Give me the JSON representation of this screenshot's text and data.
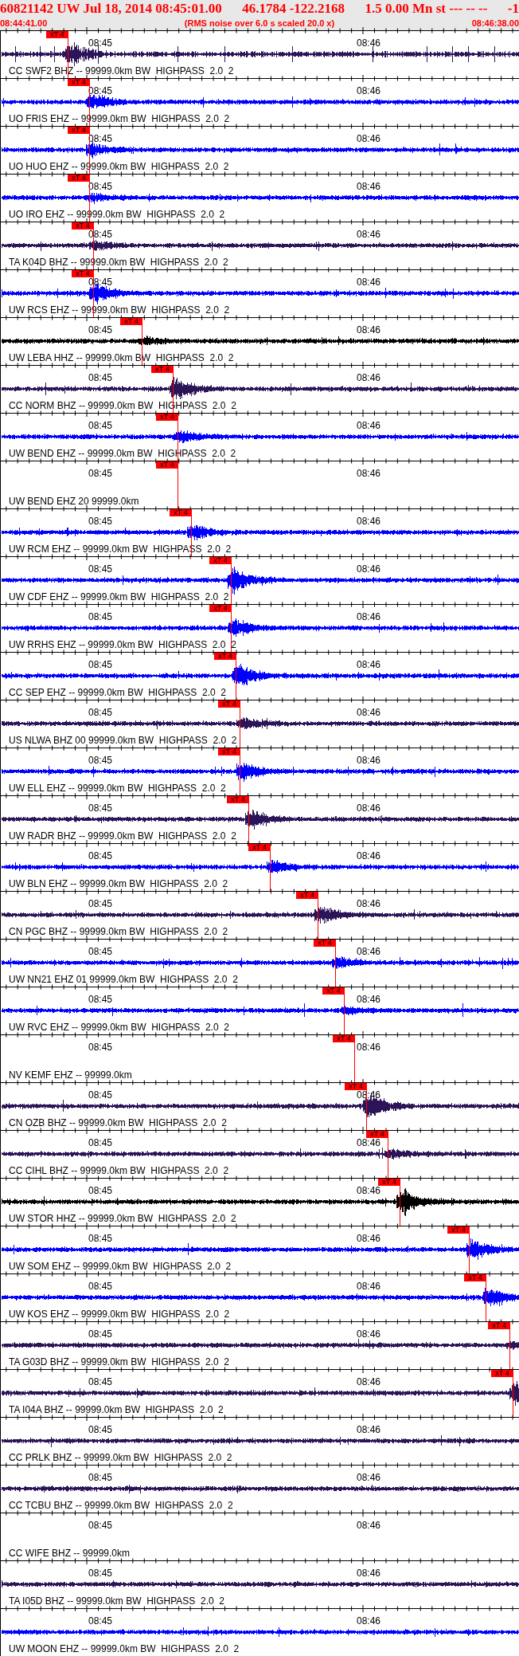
{
  "header": {
    "title_parts": [
      "60821142 UW Jul 18, 2014 08:45:01.00",
      "46.1784 -122.2168",
      "1.5 0.00 Mn st --- -- --",
      "-1"
    ],
    "start_time": "08:44:41.00",
    "note": "(RMS noise over 6.0 s scaled 20.0 x)",
    "end_time": "08:46:38.00"
  },
  "traces": [
    {
      "label": "CC SWF2 BHZ -- 99999.0km BW  HIGHPASS  2.0  2",
      "color": "#2b1457",
      "time_labels": [
        "08:45",
        "08:46"
      ],
      "pick": {
        "label": "xT 4",
        "level": 0.13
      }
    },
    {
      "label": "UO FRIS EHZ -- 99999.0km BW  HIGHPASS  2.0  2",
      "color": "#0000ff",
      "time_labels": [
        "08:45",
        "08:46"
      ],
      "pick": {
        "label": "xT 4",
        "level": 0.172
      }
    },
    {
      "label": "UO HUO EHZ -- 99999.0km BW  HIGHPASS  2.0  2",
      "color": "#0000ff",
      "time_labels": [
        "08:45",
        "08:46"
      ],
      "pick": {
        "label": "xT 4",
        "level": 0.172
      }
    },
    {
      "label": "UO IRO EHZ -- 99999.0km BW  HIGHPASS  2.0  2",
      "color": "#0000ff",
      "time_labels": [
        "08:45",
        "08:46"
      ],
      "pick": {
        "label": "xT 4",
        "level": 0.172
      }
    },
    {
      "label": "TA K04D BHZ -- 99999.0km BW  HIGHPASS  2.0  2",
      "color": "#2b1457",
      "time_labels": [
        "08:45",
        "08:46"
      ],
      "pick": {
        "label": "xT 4",
        "level": 0.179
      }
    },
    {
      "label": "UW RCS EHZ -- 99999.0km BW  HIGHPASS  2.0  2",
      "color": "#0000ff",
      "time_labels": [
        "08:45",
        "08:46"
      ],
      "pick": {
        "label": "xT 4",
        "level": 0.179
      }
    },
    {
      "label": "UW LEBA HHZ -- 99999.0km BW  HIGHPASS  2.0  2",
      "color": "#000000",
      "time_labels": [
        "08:45",
        "08:46"
      ],
      "pick": {
        "label": "xT 4",
        "level": 0.273
      }
    },
    {
      "label": "CC NORM BHZ -- 99999.0km BW  HIGHPASS  2.0  2",
      "color": "#2b1457",
      "time_labels": [
        "08:45",
        "08:46"
      ],
      "pick": {
        "label": "xT 4",
        "level": 0.333
      }
    },
    {
      "label": "UW BEND EHZ -- 99999.0km BW  HIGHPASS  2.0  2",
      "color": "#0000ff",
      "time_labels": [
        "08:45",
        "08:46"
      ],
      "pick": {
        "label": "xT 4",
        "level": 0.342
      }
    },
    {
      "label": "UW BEND EHZ 20 99999.0km",
      "time_labels": [
        "08:45",
        "08:46"
      ],
      "pick": {
        "label": "xT 4",
        "level": 0.342
      }
    },
    {
      "label": "UW RCM EHZ -- 99999.0km BW  HIGHPASS  2.0  2",
      "color": "#0000ff",
      "time_labels": [
        "08:45",
        "08:46"
      ],
      "pick": {
        "label": "xT 4",
        "level": 0.368
      }
    },
    {
      "label": "UW CDF EHZ -- 99999.0km BW  HIGHPASS  2.0  2",
      "color": "#0000ff",
      "time_labels": [
        "08:45",
        "08:46"
      ],
      "pick": {
        "label": "xT 4",
        "level": 0.445
      }
    },
    {
      "label": "UW RRHS EHZ -- 99999.0km BW  HIGHPASS  2.0  2",
      "color": "#0000ff",
      "time_labels": [
        "08:45",
        "08:46"
      ],
      "pick": {
        "label": "xT 4",
        "level": 0.445
      }
    },
    {
      "label": "CC SEP EHZ -- 99999.0km BW  HIGHPASS  2.0  2",
      "color": "#0000ff",
      "time_labels": [
        "08:45",
        "08:46"
      ],
      "pick": {
        "label": "xT 4",
        "level": 0.454
      }
    },
    {
      "label": "US NLWA BHZ 00 99999.0km BW  HIGHPASS  2.0  2",
      "color": "#2b1457",
      "time_labels": [
        "08:45",
        "08:46"
      ],
      "pick": {
        "label": "xT 4",
        "level": 0.462
      }
    },
    {
      "label": "UW ELL EHZ -- 99999.0km BW  HIGHPASS  2.0  2",
      "color": "#0000ff",
      "time_labels": [
        "08:45",
        "08:46"
      ],
      "pick": {
        "label": "xT 4",
        "level": 0.462
      }
    },
    {
      "label": "UW RADR BHZ -- 99999.0km BW  HIGHPASS  2.0  2",
      "color": "#2b1457",
      "time_labels": [
        "08:45",
        "08:46"
      ],
      "pick": {
        "label": "xT 4",
        "level": 0.48
      }
    },
    {
      "label": "UW BLN EHZ -- 99999.0km BW  HIGHPASS  2.0  2",
      "color": "#0000ff",
      "time_labels": [
        "08:45",
        "08:46"
      ],
      "pick": {
        "label": "xT 4",
        "level": 0.52
      }
    },
    {
      "label": "CN PGC BHZ -- 99999.0km BW  HIGHPASS  2.0  2",
      "color": "#2b1457",
      "time_labels": [
        "08:45",
        "08:46"
      ],
      "pick": {
        "label": "xT 4",
        "level": 0.613
      }
    },
    {
      "label": "UW NN21 EHZ 01 99999.0km BW  HIGHPASS  2.0  2",
      "color": "#0000ff",
      "time_labels": [
        "08:45",
        "08:46"
      ],
      "pick": {
        "label": "xT 4",
        "level": 0.646
      }
    },
    {
      "label": "UW RVC EHZ -- 99999.0km BW  HIGHPASS  2.0  2",
      "color": "#0000ff",
      "time_labels": [
        "08:45",
        "08:46"
      ],
      "pick": {
        "label": "xT 4",
        "level": 0.664
      }
    },
    {
      "label": "NV KEMF EHZ -- 99999.0km",
      "time_labels": [
        "08:45",
        "08:46"
      ],
      "pick": {
        "label": "xT 4",
        "level": 0.683
      }
    },
    {
      "label": "CN OZB BHZ -- 99999.0km BW  HIGHPASS  2.0  2",
      "color": "#2b1457",
      "time_labels": [
        "08:45",
        "08:46"
      ],
      "pick": {
        "label": "xT 4",
        "level": 0.707
      }
    },
    {
      "label": "CC CIHL BHZ -- 99999.0km BW  HIGHPASS  2.0  2",
      "color": "#2b1457",
      "time_labels": [
        "08:45",
        "08:46"
      ],
      "pick": {
        "label": "xT 4",
        "level": 0.748
      }
    },
    {
      "label": "UW STOR HHZ -- 99999.0km BW  HIGHPASS  2.0  2",
      "color": "#000000",
      "time_labels": [
        "08:45",
        "08:46"
      ],
      "pick": {
        "label": "xT 4",
        "level": 0.771
      }
    },
    {
      "label": "UW SOM EHZ -- 99999.0km BW  HIGHPASS  2.0  2",
      "color": "#0000ff",
      "time_labels": [
        "08:45",
        "08:46"
      ],
      "pick": {
        "label": "xT 4",
        "level": 0.905
      }
    },
    {
      "label": "UW KOS EHZ -- 99999.0km BW  HIGHPASS  2.0  2",
      "color": "#0000ff",
      "time_labels": [
        "08:45",
        "08:46"
      ],
      "pick": {
        "label": "xT 4",
        "level": 0.937
      }
    },
    {
      "label": "TA G03D BHZ -- 99999.0km BW  HIGHPASS  2.0  2",
      "color": "#2b1457",
      "time_labels": [
        "08:45",
        "08:46"
      ],
      "pick": {
        "label": "xT 4",
        "level": 0.983
      }
    },
    {
      "label": "TA I04A BHZ -- 99999.0km BW  HIGHPASS  2.0  2",
      "color": "#2b1457",
      "time_labels": [
        "08:45",
        "08:46"
      ],
      "pick": {
        "label": "xT 4",
        "level": 0.989
      }
    },
    {
      "label": "CC PRLK BHZ -- 99999.0km BW  HIGHPASS  2.0  2",
      "color": "#2b1457",
      "time_labels": [
        "08:45",
        "08:46"
      ]
    },
    {
      "label": "CC TCBU BHZ -- 99999.0km BW  HIGHPASS  2.0  2",
      "color": "#2b1457",
      "time_labels": [
        "08:45",
        "08:46"
      ]
    },
    {
      "label": "CC WIFE BHZ -- 99999.0km",
      "time_labels": [
        "08:45",
        "08:46"
      ]
    },
    {
      "label": "TA I05D BHZ -- 99999.0km BW  HIGHPASS  2.0  2",
      "color": "#2b1457",
      "time_labels": [
        "08:45",
        "08:46"
      ]
    },
    {
      "label": "UW MOON EHZ -- 99999.0km BW  HIGHPASS  2.0  2",
      "color": "#0000ff",
      "time_labels": [
        "08:45",
        "08:46"
      ]
    }
  ]
}
